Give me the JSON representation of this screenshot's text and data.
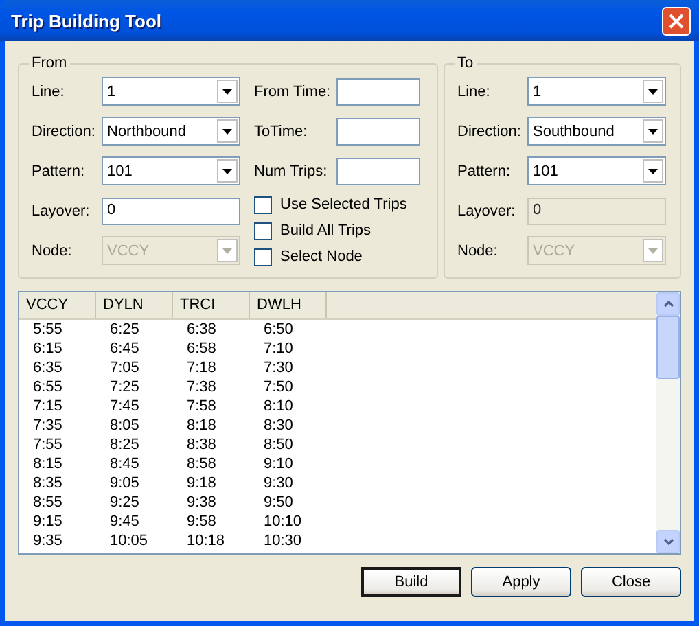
{
  "window": {
    "title": "Trip Building Tool"
  },
  "from": {
    "title": "From",
    "fields": [
      {
        "label": "Line:",
        "kind": "combo",
        "value": "1",
        "disabled": false
      },
      {
        "label": "Direction:",
        "kind": "combo",
        "value": "Northbound",
        "disabled": false
      },
      {
        "label": "Pattern:",
        "kind": "combo",
        "value": "101",
        "disabled": false
      },
      {
        "label": "Layover:",
        "kind": "text",
        "value": "0",
        "disabled": false
      },
      {
        "label": "Node:",
        "kind": "combo",
        "value": "VCCY",
        "disabled": true
      }
    ],
    "times": [
      {
        "label": "From Time:"
      },
      {
        "label": "ToTime:"
      },
      {
        "label": "Num Trips:"
      }
    ],
    "checkboxes": [
      {
        "label": "Use Selected Trips",
        "checked": false
      },
      {
        "label": "Build All Trips",
        "checked": false
      },
      {
        "label": "Select Node",
        "checked": false
      }
    ]
  },
  "to": {
    "title": "To",
    "fields": [
      {
        "label": "Line:",
        "kind": "combo",
        "value": "1",
        "disabled": false
      },
      {
        "label": "Direction:",
        "kind": "combo",
        "value": "Southbound",
        "disabled": false
      },
      {
        "label": "Pattern:",
        "kind": "combo",
        "value": "101",
        "disabled": false
      },
      {
        "label": "Layover:",
        "kind": "text",
        "value": "0",
        "disabled": true
      },
      {
        "label": "Node:",
        "kind": "combo",
        "value": "VCCY",
        "disabled": true
      }
    ]
  },
  "table": {
    "columns": [
      "VCCY",
      "DYLN",
      "TRCI",
      "DWLH"
    ],
    "rows": [
      [
        "5:55",
        "6:25",
        "6:38",
        "6:50"
      ],
      [
        "6:15",
        "6:45",
        "6:58",
        "7:10"
      ],
      [
        "6:35",
        "7:05",
        "7:18",
        "7:30"
      ],
      [
        "6:55",
        "7:25",
        "7:38",
        "7:50"
      ],
      [
        "7:15",
        "7:45",
        "7:58",
        "8:10"
      ],
      [
        "7:35",
        "8:05",
        "8:18",
        "8:30"
      ],
      [
        "7:55",
        "8:25",
        "8:38",
        "8:50"
      ],
      [
        "8:15",
        "8:45",
        "8:58",
        "9:10"
      ],
      [
        "8:35",
        "9:05",
        "9:18",
        "9:30"
      ],
      [
        "8:55",
        "9:25",
        "9:38",
        "9:50"
      ],
      [
        "9:15",
        "9:45",
        "9:58",
        "10:10"
      ],
      [
        "9:35",
        "10:05",
        "10:18",
        "10:30"
      ]
    ]
  },
  "buttons": [
    {
      "label": "Build",
      "default": true
    },
    {
      "label": "Apply",
      "default": false
    },
    {
      "label": "Close",
      "default": false
    }
  ]
}
